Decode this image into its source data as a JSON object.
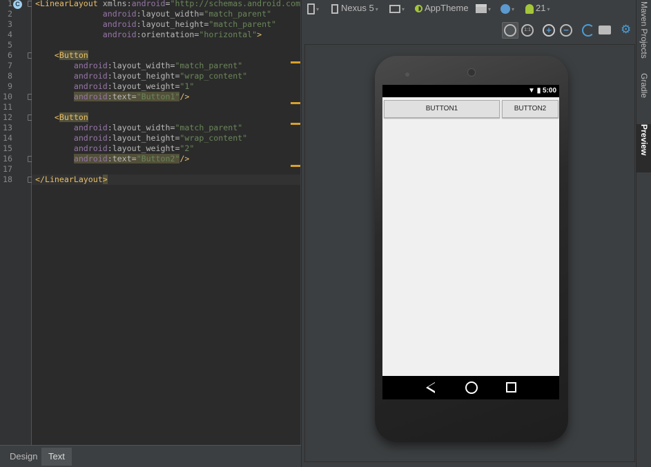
{
  "editor": {
    "line_numbers": [
      "1",
      "2",
      "3",
      "4",
      "5",
      "6",
      "7",
      "8",
      "9",
      "10",
      "11",
      "12",
      "13",
      "14",
      "15",
      "16",
      "17",
      "18"
    ],
    "lines": [
      [
        {
          "t": "<LinearLayout",
          "c": "tag"
        },
        {
          "t": " xmlns:",
          "c": "attr"
        },
        {
          "t": "android",
          "c": "attrns"
        },
        {
          "t": "=",
          "c": "attr"
        },
        {
          "t": "\"http://schemas.android.com",
          "c": "val"
        }
      ],
      [
        {
          "t": "              ",
          "c": ""
        },
        {
          "t": "android",
          "c": "attrns"
        },
        {
          "t": ":layout_width=",
          "c": "attr"
        },
        {
          "t": "\"match_parent\"",
          "c": "val"
        }
      ],
      [
        {
          "t": "              ",
          "c": ""
        },
        {
          "t": "android",
          "c": "attrns"
        },
        {
          "t": ":layout_height=",
          "c": "attr"
        },
        {
          "t": "\"match_parent\"",
          "c": "val"
        }
      ],
      [
        {
          "t": "              ",
          "c": ""
        },
        {
          "t": "android",
          "c": "attrns"
        },
        {
          "t": ":orientation=",
          "c": "attr"
        },
        {
          "t": "\"horizontal\"",
          "c": "val"
        },
        {
          "t": ">",
          "c": "tag"
        }
      ],
      [],
      [
        {
          "t": "    <",
          "c": "tag"
        },
        {
          "t": "Button",
          "c": "tag hl"
        }
      ],
      [
        {
          "t": "        ",
          "c": ""
        },
        {
          "t": "android",
          "c": "attrns"
        },
        {
          "t": ":layout_width=",
          "c": "attr"
        },
        {
          "t": "\"match_parent\"",
          "c": "val"
        }
      ],
      [
        {
          "t": "        ",
          "c": ""
        },
        {
          "t": "android",
          "c": "attrns"
        },
        {
          "t": ":layout_height=",
          "c": "attr"
        },
        {
          "t": "\"wrap_content\"",
          "c": "val"
        }
      ],
      [
        {
          "t": "        ",
          "c": ""
        },
        {
          "t": "android",
          "c": "attrns"
        },
        {
          "t": ":layout_weight=",
          "c": "attr"
        },
        {
          "t": "\"1\"",
          "c": "val"
        }
      ],
      [
        {
          "t": "        ",
          "c": ""
        },
        {
          "t": "android",
          "c": "attrns hl"
        },
        {
          "t": ":text=",
          "c": "attr hl"
        },
        {
          "t": "\"Button1\"",
          "c": "val hl"
        },
        {
          "t": "/>",
          "c": "tag"
        }
      ],
      [],
      [
        {
          "t": "    <",
          "c": "tag"
        },
        {
          "t": "Button",
          "c": "tag hl"
        }
      ],
      [
        {
          "t": "        ",
          "c": ""
        },
        {
          "t": "android",
          "c": "attrns"
        },
        {
          "t": ":layout_width=",
          "c": "attr"
        },
        {
          "t": "\"match_parent\"",
          "c": "val"
        }
      ],
      [
        {
          "t": "        ",
          "c": ""
        },
        {
          "t": "android",
          "c": "attrns"
        },
        {
          "t": ":layout_height=",
          "c": "attr"
        },
        {
          "t": "\"wrap_content\"",
          "c": "val"
        }
      ],
      [
        {
          "t": "        ",
          "c": ""
        },
        {
          "t": "android",
          "c": "attrns"
        },
        {
          "t": ":layout_weight=",
          "c": "attr"
        },
        {
          "t": "\"2\"",
          "c": "val"
        }
      ],
      [
        {
          "t": "        ",
          "c": ""
        },
        {
          "t": "android",
          "c": "attrns hl"
        },
        {
          "t": ":text=",
          "c": "attr hl"
        },
        {
          "t": "\"Button2\"",
          "c": "val hl"
        },
        {
          "t": "/>",
          "c": "tag"
        }
      ],
      [],
      [
        {
          "t": "</LinearLayout",
          "c": "tag"
        },
        {
          "t": ">",
          "c": "tag hl"
        }
      ]
    ],
    "gutter_badge": "C"
  },
  "bottom_tabs": [
    "Design",
    "Text"
  ],
  "active_bottom_tab": "Text",
  "toolbar": {
    "device": "Nexus 5",
    "theme": "AppTheme",
    "api": "21"
  },
  "phone": {
    "time": "5:00",
    "button1": "BUTTON1",
    "button2": "BUTTON2"
  },
  "right_tabs": [
    "Maven Projects",
    "Gradle",
    "Preview"
  ],
  "colors": {
    "marker": "#d9a12b",
    "accent": "#4a9fd8",
    "android_green": "#a4c639"
  }
}
